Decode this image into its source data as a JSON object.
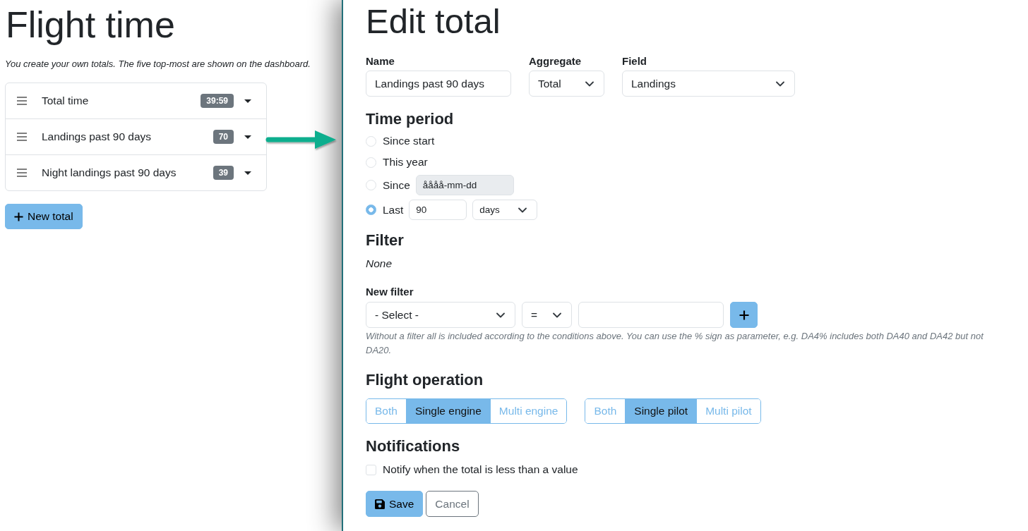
{
  "left": {
    "title": "Flight time",
    "intro": "You create your own totals. The five top-most are shown on the dashboard.",
    "totals": [
      {
        "name": "Total time",
        "value": "39:59"
      },
      {
        "name": "Landings past 90 days",
        "value": "70"
      },
      {
        "name": "Night landings past 90 days",
        "value": "39"
      }
    ],
    "new_button": "New total"
  },
  "editor": {
    "title": "Edit total",
    "fields": [
      {
        "kind": "text",
        "label": "Name",
        "value": "Landings past 90 days"
      },
      {
        "kind": "select",
        "label": "Aggregate",
        "value": "Total"
      },
      {
        "kind": "select",
        "label": "Field",
        "value": "Landings"
      }
    ],
    "time_period": {
      "heading": "Time period",
      "options": [
        {
          "kind": "plain",
          "label": "Since start",
          "selected": false
        },
        {
          "kind": "plain",
          "label": "This year",
          "selected": false
        },
        {
          "kind": "date",
          "label": "Since",
          "selected": false,
          "date": {
            "placeholder": "åååå-mm-dd",
            "disabled": true
          }
        },
        {
          "kind": "count",
          "label": "Last",
          "selected": true,
          "count": "90",
          "unit": "days"
        }
      ]
    },
    "filter": {
      "heading": "Filter",
      "current": "None",
      "new_label": "New filter",
      "field": "- Select -",
      "operator": "=",
      "help": "Without a filter all is included according to the conditions above. You can use the % sign as parameter, e.g. DA4% includes both DA40 and DA42 but not DA20."
    },
    "flight_operation": {
      "heading": "Flight operation",
      "groups": [
        {
          "options": [
            {
              "label": "Both",
              "selected": false
            },
            {
              "label": "Single engine",
              "selected": true
            },
            {
              "label": "Multi engine",
              "selected": false
            }
          ]
        },
        {
          "options": [
            {
              "label": "Both",
              "selected": false
            },
            {
              "label": "Single pilot",
              "selected": true
            },
            {
              "label": "Multi pilot",
              "selected": false
            }
          ]
        }
      ]
    },
    "notifications": {
      "heading": "Notifications",
      "options": [
        {
          "label": "Notify when the total is less than a value",
          "checked": false
        }
      ]
    },
    "actions": [
      {
        "kind": "primary",
        "label": "Save"
      },
      {
        "kind": "secondary",
        "label": "Cancel"
      }
    ]
  }
}
